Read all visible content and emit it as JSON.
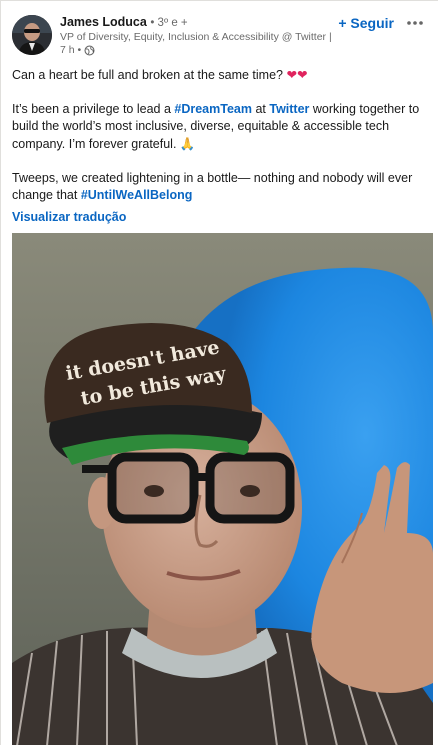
{
  "post": {
    "author": {
      "name": "James Loduca",
      "degree": "• 3º e +",
      "headline": "VP of Diversity, Equity, Inclusion & Accessibility @ Twitter | ...",
      "time": "7 h •",
      "visibility_icon": "globe-icon"
    },
    "follow_label": "+ Seguir",
    "more_icon": "more-options-icon",
    "text": {
      "line1": "Can a heart be full and broken at the same time?",
      "line1_emoji": "❤❤",
      "p2_before": "It’s been a privilege to lead a ",
      "p2_tag1": "#DreamTeam",
      "p2_mid": " at ",
      "p2_tag2": "Twitter",
      "p2_after": " working together to build the world’s most inclusive, diverse, equitable & accessible tech company. I’m forever grateful.",
      "p2_emoji": "🙏",
      "p3_before": "Tweeps, we created lightening in a bottle— nothing and nobody will ever change that ",
      "p3_tag": "#UntilWeAllBelong"
    },
    "translate_label": "Visualizar tradução",
    "photo": {
      "cap_text_line1": "it doesn't have",
      "cap_text_line2": "to be this way"
    }
  },
  "colors": {
    "link": "#0a66c2",
    "heart": "#e0245e",
    "background": "#f3f2ef"
  }
}
